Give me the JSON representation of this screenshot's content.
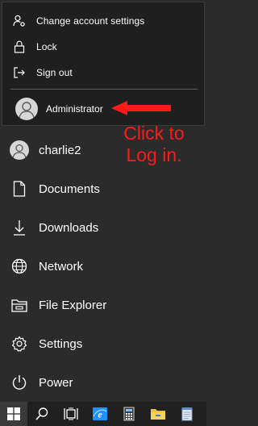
{
  "account_flyout": {
    "items": [
      {
        "label": "Change account settings",
        "icon": "person-gear-icon"
      },
      {
        "label": "Lock",
        "icon": "lock-icon"
      },
      {
        "label": "Sign out",
        "icon": "sign-out-icon"
      }
    ],
    "current_user": {
      "label": "Administrator",
      "icon": "user-avatar-icon"
    }
  },
  "annotation": {
    "text_line1": "Click to",
    "text_line2": "Log in.",
    "color": "#ff1a1a"
  },
  "start_menu": {
    "items": [
      {
        "label": "charlie2",
        "icon": "user-avatar-icon"
      },
      {
        "label": "Documents",
        "icon": "document-icon"
      },
      {
        "label": "Downloads",
        "icon": "download-icon"
      },
      {
        "label": "Network",
        "icon": "network-icon"
      },
      {
        "label": "File Explorer",
        "icon": "file-explorer-icon"
      },
      {
        "label": "Settings",
        "icon": "gear-icon"
      },
      {
        "label": "Power",
        "icon": "power-icon"
      }
    ]
  },
  "taskbar": {
    "buttons": [
      "windows-start-icon",
      "search-icon",
      "task-view-icon",
      "ie-icon",
      "calculator-icon",
      "folder-icon",
      "notepad-icon"
    ]
  },
  "colors": {
    "background": "#2b2b2b",
    "flyout_background": "#1f1f1f",
    "taskbar": "#202020",
    "accent_blue": "#1e90ff"
  }
}
